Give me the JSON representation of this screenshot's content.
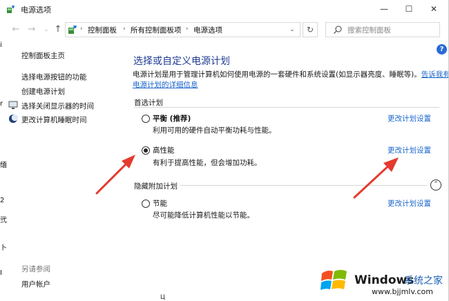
{
  "window": {
    "title": "电源选项"
  },
  "caption": {
    "minimize": "—",
    "maximize": "☐",
    "close": "✕"
  },
  "nav": {
    "back": "←",
    "forward": "→",
    "dropdown": "⌄",
    "up": "↑"
  },
  "address": {
    "crumbs": [
      "控制面板",
      "所有控制面板项",
      "电源选项"
    ],
    "separator": "›",
    "dropdown": "⌄",
    "refresh": "↻"
  },
  "search": {
    "placeholder": "搜索控制面板"
  },
  "sidebar": {
    "items": [
      {
        "label": "控制面板主页",
        "icon": ""
      },
      {
        "label": "选择电源按钮的功能",
        "icon": ""
      },
      {
        "label": "创建电源计划",
        "icon": ""
      },
      {
        "label": "选择关闭显示器的时间",
        "icon": "monitor-icon"
      },
      {
        "label": "更改计算机睡眠时间",
        "icon": "moon-icon"
      }
    ],
    "see_also": "另请参阅",
    "user_accounts": "用户帐户"
  },
  "help": "?",
  "main": {
    "heading": "选择或自定义电源计划",
    "description": "电源计划是用于管理计算机如何使用电源的一套硬件和系统设置(如显示器亮度、睡眠等)。",
    "learn_more_part1": "告诉我有关",
    "learn_more_part2": "电源计划的详细信息",
    "preferred_label": "首选计划",
    "hidden_label": "隐藏附加计划",
    "collapse": "⌃",
    "change_settings": "更改计划设置",
    "plans": [
      {
        "name": "平衡 (推荐)",
        "desc": "利用可用的硬件自动平衡功耗与性能。",
        "selected": false
      },
      {
        "name": "高性能",
        "desc": "有利于提高性能，但会增加功耗。",
        "selected": true
      },
      {
        "name": "节能",
        "desc": "尽可能降低计算机性能以节能。",
        "selected": false
      }
    ]
  },
  "edge_fragments": [
    "i",
    "r",
    "缅",
    "2",
    "弐",
    "卜",
    "Ц",
    "I"
  ],
  "watermark": {
    "brand": "Windows",
    "site_name": "系统之家",
    "url": "www.bjjmlv.com"
  },
  "colors": {
    "heading": "#1f3a93",
    "link": "#1a66cc",
    "arrow": "#e53a2f",
    "help_badge": "#2a6ad6"
  }
}
